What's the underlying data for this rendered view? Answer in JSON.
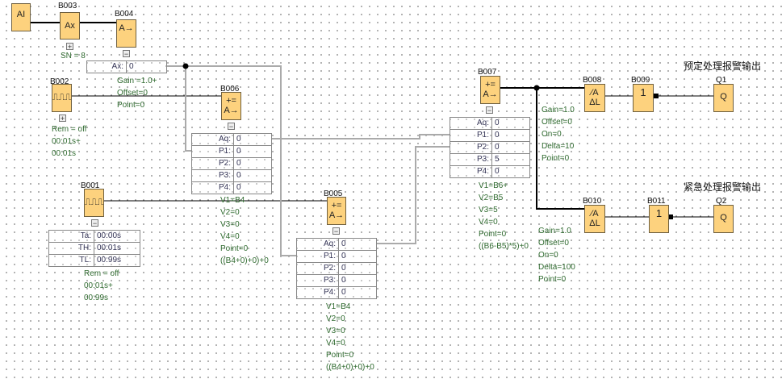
{
  "titles": {
    "q1": "预定处理报警输出",
    "q2": "紧急处理报警输出"
  },
  "ai": {
    "label": "AI"
  },
  "b003": {
    "name": "B003",
    "symbol": "Ax",
    "param": "SN = 8"
  },
  "b004": {
    "name": "B004",
    "symbol": "A→",
    "param_row": {
      "k": "Ax:",
      "v": "0"
    },
    "params": [
      "Gain =1.0+",
      "Offset=0",
      "Point=0"
    ]
  },
  "b002": {
    "name": "B002",
    "symbol": "⎍⎍⎍",
    "params": [
      "Rem = off",
      "00:01s+",
      "00:01s"
    ]
  },
  "b006": {
    "name": "B006",
    "symbol": "+=\nA→",
    "rows": [
      {
        "k": "Aq:",
        "v": "0"
      },
      {
        "k": "P1:",
        "v": "0"
      },
      {
        "k": "P2:",
        "v": "0"
      },
      {
        "k": "P3:",
        "v": "0"
      },
      {
        "k": "P4:",
        "v": "0"
      }
    ],
    "params": [
      "V1=B4",
      "V2=0",
      "V3=0",
      "V4=0",
      "Point=0",
      "((B4+0)+0)+0"
    ]
  },
  "b001": {
    "name": "B001",
    "symbol": "⎍⎍⎍",
    "rows": [
      {
        "k": "Ta:",
        "v": "00:00s"
      },
      {
        "k": "TH:",
        "v": "00:01s"
      },
      {
        "k": "TL:",
        "v": "00:99s"
      }
    ],
    "params": [
      "Rem = off",
      "00:01s+",
      "00:99s"
    ]
  },
  "b005": {
    "name": "B005",
    "symbol": "+=\nA→",
    "rows": [
      {
        "k": "Aq:",
        "v": "0"
      },
      {
        "k": "P1:",
        "v": "0"
      },
      {
        "k": "P2:",
        "v": "0"
      },
      {
        "k": "P3:",
        "v": "0"
      },
      {
        "k": "P4:",
        "v": "0"
      }
    ],
    "params": [
      "V1=B4",
      "V2=0",
      "V3=0",
      "V4=0",
      "Point=0",
      "((B4+0)+0)+0"
    ]
  },
  "b007": {
    "name": "B007",
    "symbol": "+=\nA→",
    "rows": [
      {
        "k": "Aq:",
        "v": "0"
      },
      {
        "k": "P1:",
        "v": "0"
      },
      {
        "k": "P2:",
        "v": "0"
      },
      {
        "k": "P3:",
        "v": "5"
      },
      {
        "k": "P4:",
        "v": "0"
      }
    ],
    "params": [
      "V1=B6+",
      "V2=B5",
      "V3=5",
      "V4=0",
      "Point=0",
      "((B6-B5)*5)+0"
    ]
  },
  "b008": {
    "name": "B008",
    "symbol": "⁄A\nΔL",
    "params": [
      "Gain=1.0",
      "Offset=0",
      "On=0",
      "Delta=10",
      "Point=0"
    ]
  },
  "b009": {
    "name": "B009",
    "symbol": "1"
  },
  "q1": {
    "name": "Q1",
    "symbol": "Q"
  },
  "b010": {
    "name": "B010",
    "symbol": "⁄A\nΔL",
    "params": [
      "Gain=1.0",
      "Offset=0",
      "On=0",
      "Delta=100",
      "Point=0"
    ]
  },
  "b011": {
    "name": "B011",
    "symbol": "1"
  },
  "q2": {
    "name": "Q2",
    "symbol": "Q"
  },
  "colors": {
    "block": "#fdd27e",
    "param_text": "#2f6a2f"
  }
}
